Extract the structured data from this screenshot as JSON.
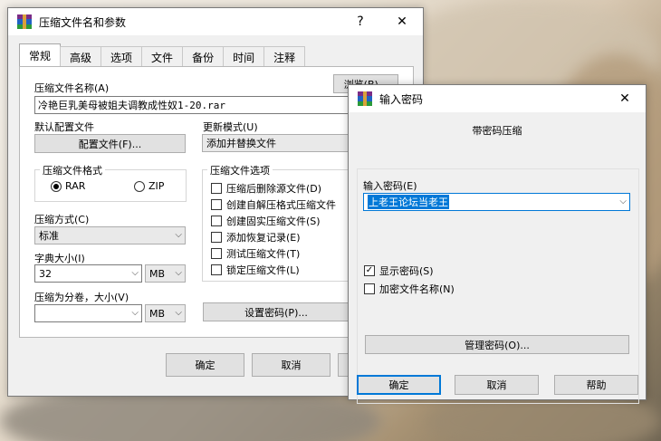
{
  "main_dialog": {
    "title": "压缩文件名和参数",
    "help_btn": "?",
    "close_btn": "✕",
    "tabs": [
      {
        "label": "常规"
      },
      {
        "label": "高级"
      },
      {
        "label": "选项"
      },
      {
        "label": "文件"
      },
      {
        "label": "备份"
      },
      {
        "label": "时间"
      },
      {
        "label": "注释"
      }
    ],
    "archive_name_label": "压缩文件名称(A)",
    "browse_btn": "浏览(B)...",
    "archive_name_value": "冷艳巨乳美母被姐夫调教成性奴1-20.rar",
    "default_profile_label": "默认配置文件",
    "profile_btn": "配置文件(F)...",
    "update_mode_label": "更新模式(U)",
    "update_mode_value": "添加并替换文件",
    "format_group_title": "压缩文件格式",
    "format_rar": "RAR",
    "format_zip": "ZIP",
    "options_group_title": "压缩文件选项",
    "options": [
      {
        "label": "压缩后删除源文件(D)"
      },
      {
        "label": "创建自解压格式压缩文件"
      },
      {
        "label": "创建固实压缩文件(S)"
      },
      {
        "label": "添加恢复记录(E)"
      },
      {
        "label": "测试压缩文件(T)"
      },
      {
        "label": "锁定压缩文件(L)"
      }
    ],
    "method_label": "压缩方式(C)",
    "method_value": "标准",
    "dict_label": "字典大小(I)",
    "dict_value": "32",
    "dict_unit": "MB",
    "split_label": "压缩为分卷，大小(V)",
    "split_value": "",
    "split_unit": "MB",
    "set_password_btn": "设置密码(P)...",
    "ok_btn": "确定",
    "cancel_btn": "取消"
  },
  "password_dialog": {
    "title": "输入密码",
    "close_btn": "✕",
    "heading": "带密码压缩",
    "password_label": "输入密码(E)",
    "password_value": "上老王论坛当老王",
    "show_password": "显示密码(S)",
    "show_password_checked": true,
    "encrypt_names": "加密文件名称(N)",
    "encrypt_names_checked": false,
    "manage_btn": "管理密码(O)...",
    "ok_btn": "确定",
    "cancel_btn": "取消",
    "help_btn": "帮助"
  }
}
